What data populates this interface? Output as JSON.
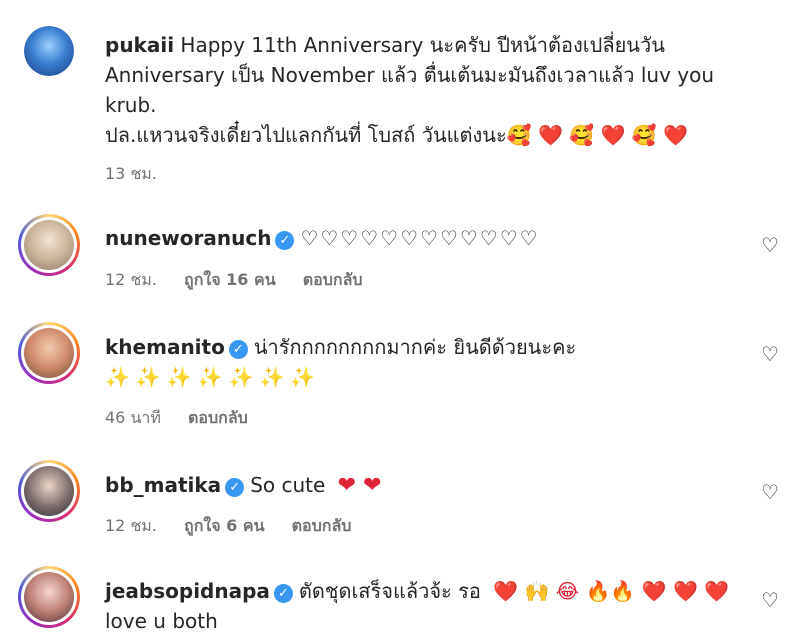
{
  "comments": [
    {
      "username": "pukaii",
      "verified": false,
      "text_line1": "Happy 11th Anniversary นะครับ ปีหน้าต้องเปลี่ยนวัน",
      "text_line2": "Anniversary เป็น November แล้ว ตื่นเต้นมะมันถึงเวลาแล้ว luv you",
      "text_line3": "krub.",
      "text_line4": "ปล.แหวนจริงเดี๋ยวไปแลกกันที่ โบสถ์ วันแต่งนะ🥰 ❤️ 🥰 ❤️ 🥰 ❤️",
      "time": "13 ชม.",
      "likes": "",
      "reply": ""
    },
    {
      "username": "nuneworanuch",
      "verified": true,
      "text": "♡♡♡♡♡♡♡♡♡♡♡♡",
      "time": "12 ชม.",
      "likes": "ถูกใจ 16 คน",
      "reply": "ตอบกลับ"
    },
    {
      "username": "khemanito",
      "verified": true,
      "text": "น่ารักกกกกกกกมากค่ะ ยินดีด้วยนะคะ",
      "text_line2": "✨✨✨✨✨✨✨",
      "time": "46 นาที",
      "likes": "",
      "reply": "ตอบกลับ"
    },
    {
      "username": "bb_matika",
      "verified": true,
      "text": "So cute",
      "hearts": "❤ ❤",
      "time": "12 ชม.",
      "likes": "ถูกใจ 6 คน",
      "reply": "ตอบกลับ"
    },
    {
      "username": "jeabsopidnapa",
      "verified": true,
      "text": "ตัดชุดเสร็จแล้วจ้ะ รอ",
      "emojis": "❤️ 🙌 😂 🔥🔥 ❤️ ❤️ ❤️",
      "text_line2": "love u both",
      "time": "",
      "likes": "",
      "reply": ""
    }
  ],
  "icons": {
    "like": "heart-outline-icon",
    "verified": "verified-badge-icon"
  },
  "colors": {
    "verified": "#3897f0",
    "muted": "#737373",
    "heart": "#e0223a"
  }
}
